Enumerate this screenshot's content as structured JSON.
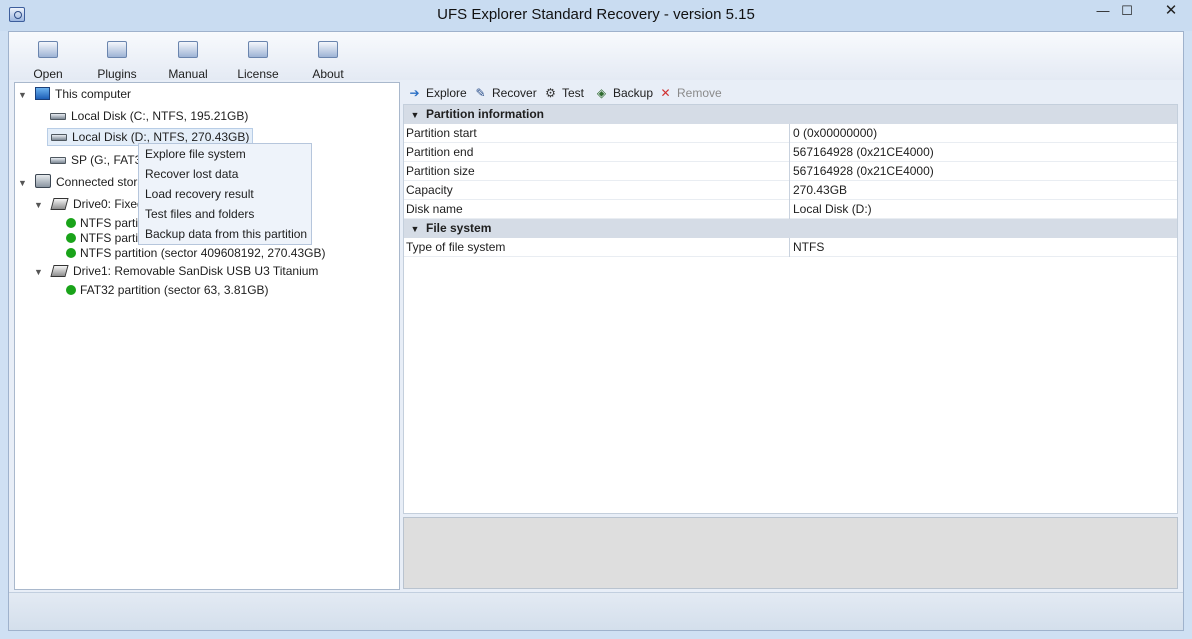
{
  "window": {
    "title": "UFS Explorer Standard Recovery - version 5.15",
    "minimize": "—",
    "maximize": "☐",
    "close": "✕"
  },
  "toolbar": {
    "items": [
      {
        "label": "Open",
        "icon": "open-folder-icon"
      },
      {
        "label": "Plugins",
        "icon": "plugins-icon"
      },
      {
        "label": "Manual",
        "icon": "manual-book-icon"
      },
      {
        "label": "License",
        "icon": "license-icon"
      },
      {
        "label": "About",
        "icon": "about-icon"
      }
    ]
  },
  "tree": {
    "this_computer": "This computer",
    "local_c": "Local Disk (C:, NTFS, 195.21GB)",
    "local_d": "Local Disk (D:, NTFS, 270.43GB)",
    "sp_g": "SP (G:, FAT32",
    "connected": "Connected storag",
    "drive0": "Drive0: Fixed",
    "ntfs1": "NTFS partitio",
    "ntfs2": "NTFS partitio",
    "ntfs3": "NTFS partition (sector 409608192, 270.43GB)",
    "drive1": "Drive1: Removable SanDisk USB U3 Titanium",
    "fat32": "FAT32 partition (sector 63, 3.81GB)"
  },
  "context_menu": {
    "items": [
      "Explore file system",
      "Recover lost data",
      "Load recovery result",
      "Test files and folders",
      "Backup data from this partition"
    ]
  },
  "right_toolbar": {
    "explore": "Explore",
    "recover": "Recover",
    "test": "Test",
    "backup": "Backup",
    "remove": "Remove"
  },
  "properties": {
    "partition_section": "Partition information",
    "partition_rows": [
      {
        "key": "Partition start",
        "value": "0 (0x00000000)"
      },
      {
        "key": "Partition end",
        "value": "567164928 (0x21CE4000)"
      },
      {
        "key": "Partition size",
        "value": "567164928 (0x21CE4000)"
      },
      {
        "key": "Capacity",
        "value": "270.43GB"
      },
      {
        "key": "Disk name",
        "value": "Local Disk (D:)"
      }
    ],
    "fs_section": "File system",
    "fs_rows": [
      {
        "key": "Type of file system",
        "value": "NTFS"
      }
    ]
  },
  "colors": {
    "accent": "#c9dcf1",
    "status_green": "#19a319",
    "remove_red": "#d03030"
  }
}
